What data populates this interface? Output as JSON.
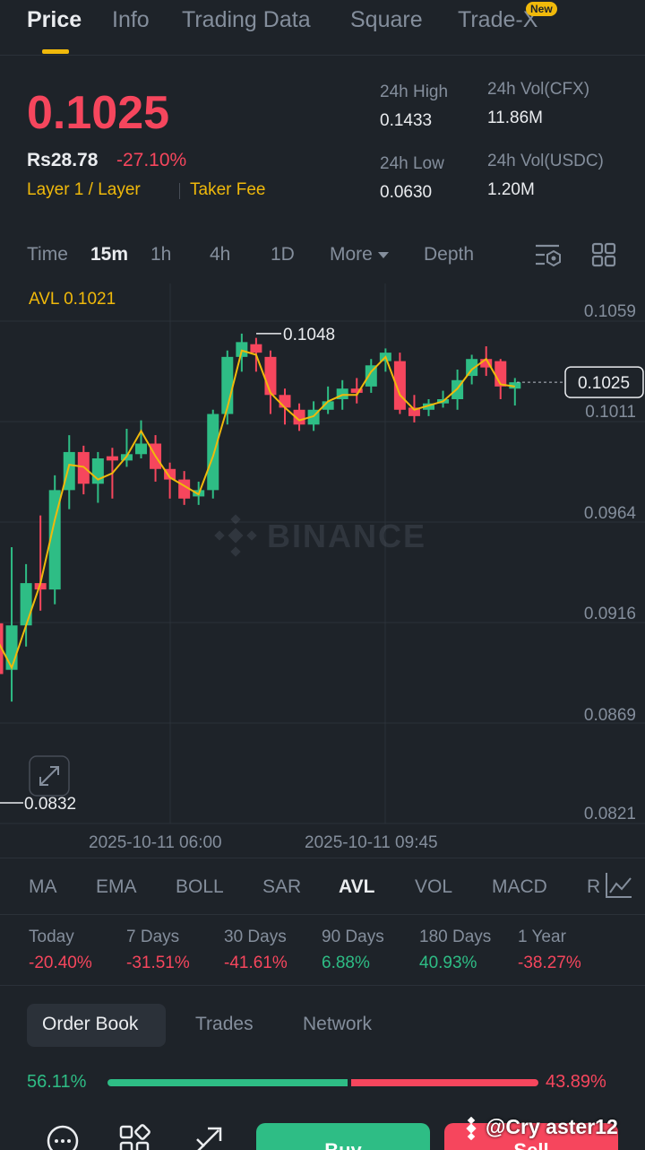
{
  "tabs": [
    {
      "label": "Price",
      "active": true
    },
    {
      "label": "Info"
    },
    {
      "label": "Trading Data"
    },
    {
      "label": "Square"
    },
    {
      "label": "Trade-X"
    }
  ],
  "tabs_badge": "New",
  "header": {
    "price": "0.1025",
    "fiat": "Rs28.78",
    "change": "-27.10%",
    "tag1": "Layer 1 / Layer",
    "tag2": "Taker Fee",
    "high_label": "24h High",
    "high_value": "0.1433",
    "low_label": "24h Low",
    "low_value": "0.0630",
    "vol1_label": "24h Vol(CFX)",
    "vol1_value": "11.86M",
    "vol2_label": "24h Vol(USDC)",
    "vol2_value": "1.20M"
  },
  "timeframes": [
    "Time",
    "15m",
    "1h",
    "4h",
    "1D",
    "More",
    "Depth"
  ],
  "active_timeframe": "15m",
  "chart_data": {
    "type": "candlestick",
    "indicator_label": "AVL 0.1021",
    "watermark": "BINANCE",
    "y_ticks": [
      "0.1059",
      "0.1011",
      "0.0964",
      "0.0916",
      "0.0869",
      "0.0821"
    ],
    "ylim": [
      0.0821,
      0.1059
    ],
    "x_ticks": [
      "2025-10-11 06:00",
      "2025-10-11 09:45"
    ],
    "current_price_label": "0.1025",
    "current_price": 0.1025,
    "high_marker": "0.1048",
    "low_marker": "0.0832",
    "candles": [
      {
        "o": 0.0911,
        "c": 0.0887,
        "h": 0.0927,
        "l": 0.0881
      },
      {
        "o": 0.0889,
        "c": 0.091,
        "h": 0.0947,
        "l": 0.0874
      },
      {
        "o": 0.091,
        "c": 0.093,
        "h": 0.0939,
        "l": 0.09
      },
      {
        "o": 0.093,
        "c": 0.0927,
        "h": 0.0962,
        "l": 0.0917
      },
      {
        "o": 0.0927,
        "c": 0.0974,
        "h": 0.0981,
        "l": 0.092
      },
      {
        "o": 0.0974,
        "c": 0.0992,
        "h": 0.1,
        "l": 0.0965
      },
      {
        "o": 0.0992,
        "c": 0.0977,
        "h": 0.0995,
        "l": 0.0972
      },
      {
        "o": 0.0977,
        "c": 0.0989,
        "h": 0.0992,
        "l": 0.0968
      },
      {
        "o": 0.099,
        "c": 0.0988,
        "h": 0.0994,
        "l": 0.097
      },
      {
        "o": 0.0988,
        "c": 0.0991,
        "h": 0.1003,
        "l": 0.0985
      },
      {
        "o": 0.0991,
        "c": 0.0996,
        "h": 0.1007,
        "l": 0.0989
      },
      {
        "o": 0.0996,
        "c": 0.0984,
        "h": 0.1,
        "l": 0.0978
      },
      {
        "o": 0.0984,
        "c": 0.0979,
        "h": 0.0987,
        "l": 0.097
      },
      {
        "o": 0.0979,
        "c": 0.097,
        "h": 0.0983,
        "l": 0.0967
      },
      {
        "o": 0.0971,
        "c": 0.0974,
        "h": 0.0978,
        "l": 0.0967
      },
      {
        "o": 0.0974,
        "c": 0.101,
        "h": 0.1012,
        "l": 0.097
      },
      {
        "o": 0.101,
        "c": 0.1037,
        "h": 0.104,
        "l": 0.1005
      },
      {
        "o": 0.1037,
        "c": 0.1044,
        "h": 0.1048,
        "l": 0.103
      },
      {
        "o": 0.1043,
        "c": 0.1039,
        "h": 0.1046,
        "l": 0.103
      },
      {
        "o": 0.1037,
        "c": 0.1019,
        "h": 0.104,
        "l": 0.101
      },
      {
        "o": 0.1019,
        "c": 0.1013,
        "h": 0.1022,
        "l": 0.1005
      },
      {
        "o": 0.1012,
        "c": 0.1005,
        "h": 0.1015,
        "l": 0.1002
      },
      {
        "o": 0.1005,
        "c": 0.1012,
        "h": 0.1016,
        "l": 0.1002
      },
      {
        "o": 0.1012,
        "c": 0.1016,
        "h": 0.1023,
        "l": 0.101
      },
      {
        "o": 0.1017,
        "c": 0.1022,
        "h": 0.1026,
        "l": 0.1012
      },
      {
        "o": 0.1022,
        "c": 0.102,
        "h": 0.1027,
        "l": 0.1015
      },
      {
        "o": 0.1023,
        "c": 0.1033,
        "h": 0.1036,
        "l": 0.102
      },
      {
        "o": 0.1035,
        "c": 0.1039,
        "h": 0.1041,
        "l": 0.103
      },
      {
        "o": 0.1035,
        "c": 0.1012,
        "h": 0.1039,
        "l": 0.101
      },
      {
        "o": 0.1013,
        "c": 0.1009,
        "h": 0.1019,
        "l": 0.1006
      },
      {
        "o": 0.1012,
        "c": 0.1015,
        "h": 0.1017,
        "l": 0.1009
      },
      {
        "o": 0.1015,
        "c": 0.1017,
        "h": 0.1021,
        "l": 0.1013
      },
      {
        "o": 0.1017,
        "c": 0.1026,
        "h": 0.1031,
        "l": 0.1012
      },
      {
        "o": 0.1028,
        "c": 0.1036,
        "h": 0.1038,
        "l": 0.1024
      },
      {
        "o": 0.1036,
        "c": 0.1032,
        "h": 0.1042,
        "l": 0.1028
      },
      {
        "o": 0.1035,
        "c": 0.1023,
        "h": 0.1036,
        "l": 0.1017
      },
      {
        "o": 0.1022,
        "c": 0.1025,
        "h": 0.1027,
        "l": 0.1014
      }
    ],
    "avl": [
      0.0903,
      0.089,
      0.091,
      0.093,
      0.096,
      0.0986,
      0.0985,
      0.0979,
      0.0982,
      0.099,
      0.1002,
      0.099,
      0.098,
      0.0976,
      0.0972,
      0.099,
      0.1013,
      0.104,
      0.1038,
      0.102,
      0.1013,
      0.1007,
      0.1009,
      0.1016,
      0.1019,
      0.1019,
      0.103,
      0.1037,
      0.1019,
      0.1012,
      0.1014,
      0.1016,
      0.1022,
      0.1031,
      0.1036,
      0.1024,
      0.1023
    ]
  },
  "indicators": [
    "MA",
    "EMA",
    "BOLL",
    "SAR",
    "AVL",
    "VOL",
    "MACD",
    "R"
  ],
  "active_indicator": "AVL",
  "performance": [
    {
      "label": "Today",
      "value": "-20.40%",
      "dir": "down"
    },
    {
      "label": "7 Days",
      "value": "-31.51%",
      "dir": "down"
    },
    {
      "label": "30 Days",
      "value": "-41.61%",
      "dir": "down"
    },
    {
      "label": "90 Days",
      "value": "6.88%",
      "dir": "up"
    },
    {
      "label": "180 Days",
      "value": "40.93%",
      "dir": "up"
    },
    {
      "label": "1 Year",
      "value": "-38.27%",
      "dir": "down"
    }
  ],
  "book_tabs": [
    "Order Book",
    "Trades",
    "Network"
  ],
  "book": {
    "bid_pct": "56.11%",
    "ask_pct": "43.89%",
    "bid_ratio": 0.5611
  },
  "actions": {
    "buy": "Buy",
    "sell": "Sell"
  },
  "watermark_user": "@Cry aster12",
  "colors": {
    "up": "#2ebd85",
    "down": "#f6465d",
    "accent": "#f0b90b",
    "bg": "#1e2329"
  }
}
